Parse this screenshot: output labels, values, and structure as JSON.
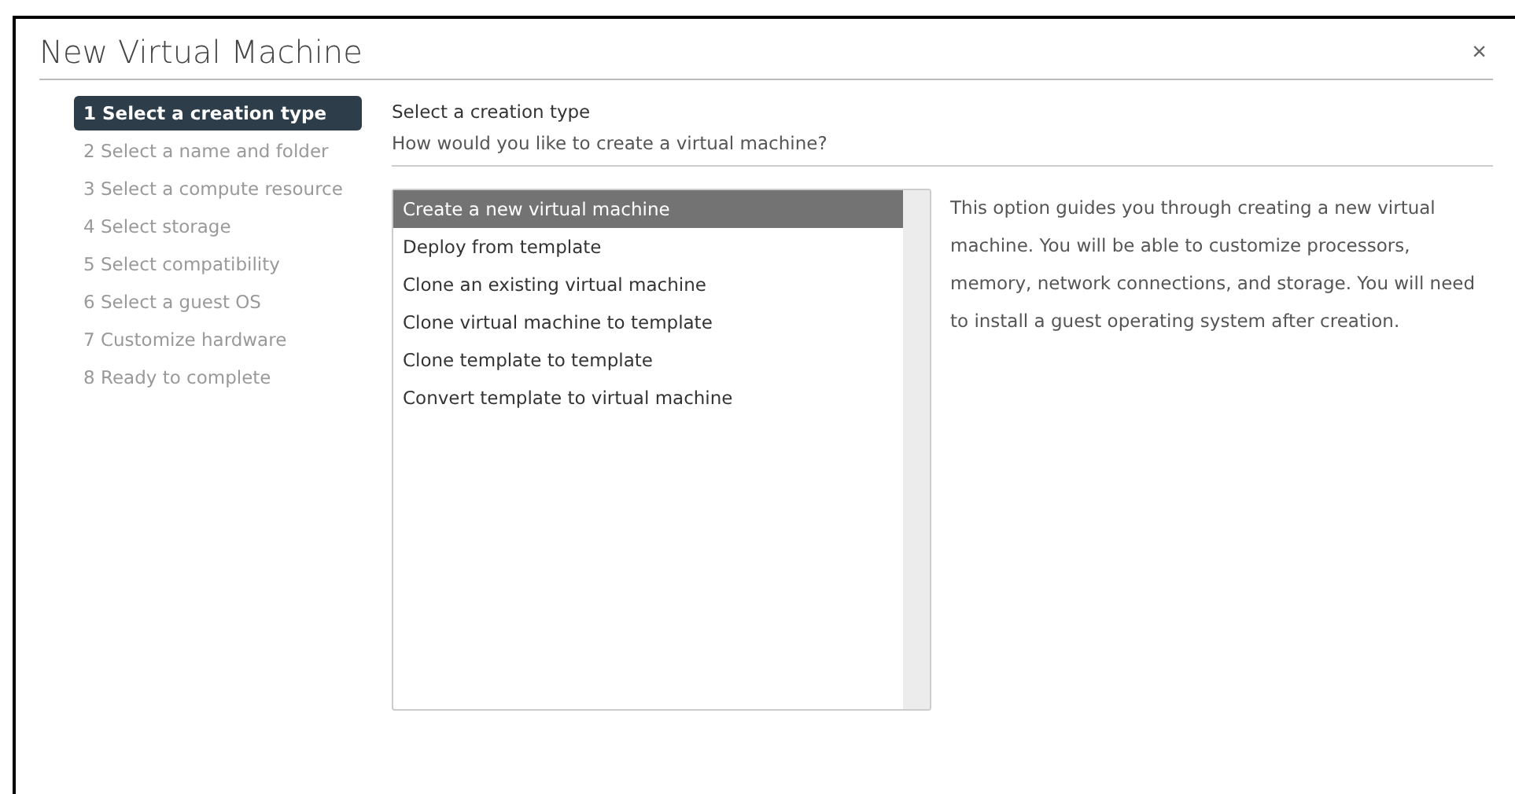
{
  "dialog": {
    "title": "New Virtual Machine",
    "close": "×"
  },
  "steps": [
    {
      "label": "1 Select a creation type",
      "selected": true
    },
    {
      "label": "2 Select a name and folder",
      "selected": false
    },
    {
      "label": "3 Select a compute resource",
      "selected": false
    },
    {
      "label": "4 Select storage",
      "selected": false
    },
    {
      "label": "5 Select compatibility",
      "selected": false
    },
    {
      "label": "6 Select a guest OS",
      "selected": false
    },
    {
      "label": "7 Customize hardware",
      "selected": false
    },
    {
      "label": "8 Ready to complete",
      "selected": false
    }
  ],
  "page": {
    "heading": "Select a creation type",
    "question": "How would you like to create a virtual machine?"
  },
  "options": [
    {
      "label": "Create a new virtual machine",
      "selected": true
    },
    {
      "label": "Deploy from template",
      "selected": false
    },
    {
      "label": "Clone an existing virtual machine",
      "selected": false
    },
    {
      "label": "Clone virtual machine to template",
      "selected": false
    },
    {
      "label": "Clone template to template",
      "selected": false
    },
    {
      "label": "Convert template to virtual machine",
      "selected": false
    }
  ],
  "description": "This option guides you through creating a new virtual machine. You will be able to customize processors, memory, network connections, and storage. You will need to install a guest operating system after creation."
}
